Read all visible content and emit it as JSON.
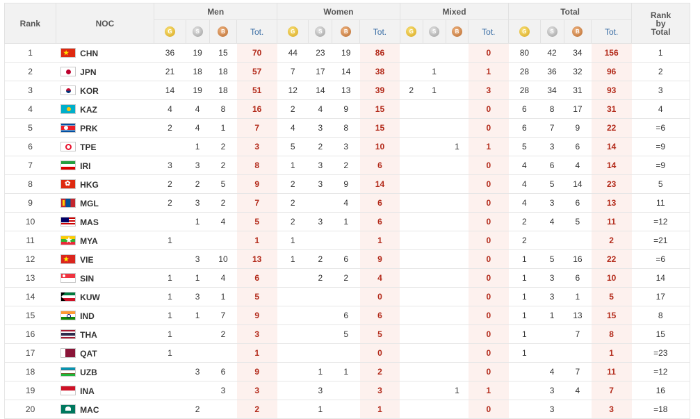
{
  "headers": {
    "rank": "Rank",
    "noc": "NOC",
    "groups": [
      "Men",
      "Women",
      "Mixed",
      "Total"
    ],
    "tot": "Tot.",
    "rank_by_total": [
      "Rank",
      "by",
      "Total"
    ],
    "medal_letters": {
      "gold": "G",
      "silver": "S",
      "bronze": "B"
    }
  },
  "colors": {
    "header_bg": "#f2f2f2",
    "total_cell_bg": "#fdf1ee",
    "total_text": "#b32a1a",
    "tot_header_text": "#3a6ea5"
  },
  "rows": [
    {
      "rank": "1",
      "noc": "CHN",
      "flag": "china-flag",
      "flag_colors": [
        "#de2910",
        "#ffde00"
      ],
      "men": [
        "36",
        "19",
        "15",
        "70"
      ],
      "women": [
        "44",
        "23",
        "19",
        "86"
      ],
      "mixed": [
        "",
        "",
        "",
        "0"
      ],
      "total": [
        "80",
        "42",
        "34",
        "156"
      ],
      "rbt": "1"
    },
    {
      "rank": "2",
      "noc": "JPN",
      "flag": "japan-flag",
      "flag_colors": [
        "#ffffff",
        "#bc002d"
      ],
      "men": [
        "21",
        "18",
        "18",
        "57"
      ],
      "women": [
        "7",
        "17",
        "14",
        "38"
      ],
      "mixed": [
        "",
        "1",
        "",
        "1"
      ],
      "total": [
        "28",
        "36",
        "32",
        "96"
      ],
      "rbt": "2"
    },
    {
      "rank": "3",
      "noc": "KOR",
      "flag": "korea-flag",
      "flag_colors": [
        "#ffffff",
        "#c60c30",
        "#003478"
      ],
      "men": [
        "14",
        "19",
        "18",
        "51"
      ],
      "women": [
        "12",
        "14",
        "13",
        "39"
      ],
      "mixed": [
        "2",
        "1",
        "",
        "3"
      ],
      "total": [
        "28",
        "34",
        "31",
        "93"
      ],
      "rbt": "3"
    },
    {
      "rank": "4",
      "noc": "KAZ",
      "flag": "kazakhstan-flag",
      "flag_colors": [
        "#00afca",
        "#fec50c"
      ],
      "men": [
        "4",
        "4",
        "8",
        "16"
      ],
      "women": [
        "2",
        "4",
        "9",
        "15"
      ],
      "mixed": [
        "",
        "",
        "",
        "0"
      ],
      "total": [
        "6",
        "8",
        "17",
        "31"
      ],
      "rbt": "4"
    },
    {
      "rank": "5",
      "noc": "PRK",
      "flag": "north-korea-flag",
      "flag_colors": [
        "#024fa2",
        "#ed1c27",
        "#ffffff"
      ],
      "men": [
        "2",
        "4",
        "1",
        "7"
      ],
      "women": [
        "4",
        "3",
        "8",
        "15"
      ],
      "mixed": [
        "",
        "",
        "",
        "0"
      ],
      "total": [
        "6",
        "7",
        "9",
        "22"
      ],
      "rbt": "=6"
    },
    {
      "rank": "6",
      "noc": "TPE",
      "flag": "chinese-taipei-flag",
      "flag_colors": [
        "#ffffff",
        "#1c3f94",
        "#e8112d"
      ],
      "men": [
        "",
        "1",
        "2",
        "3"
      ],
      "women": [
        "5",
        "2",
        "3",
        "10"
      ],
      "mixed": [
        "",
        "",
        "1",
        "1"
      ],
      "total": [
        "5",
        "3",
        "6",
        "14"
      ],
      "rbt": "=9"
    },
    {
      "rank": "7",
      "noc": "IRI",
      "flag": "iran-flag",
      "flag_colors": [
        "#239f40",
        "#ffffff",
        "#da0000"
      ],
      "men": [
        "3",
        "3",
        "2",
        "8"
      ],
      "women": [
        "1",
        "3",
        "2",
        "6"
      ],
      "mixed": [
        "",
        "",
        "",
        "0"
      ],
      "total": [
        "4",
        "6",
        "4",
        "14"
      ],
      "rbt": "=9"
    },
    {
      "rank": "8",
      "noc": "HKG",
      "flag": "hong-kong-flag",
      "flag_colors": [
        "#de2910",
        "#ffffff"
      ],
      "men": [
        "2",
        "2",
        "5",
        "9"
      ],
      "women": [
        "2",
        "3",
        "9",
        "14"
      ],
      "mixed": [
        "",
        "",
        "",
        "0"
      ],
      "total": [
        "4",
        "5",
        "14",
        "23"
      ],
      "rbt": "5"
    },
    {
      "rank": "9",
      "noc": "MGL",
      "flag": "mongolia-flag",
      "flag_colors": [
        "#c4272f",
        "#015197",
        "#f9cf02"
      ],
      "men": [
        "2",
        "3",
        "2",
        "7"
      ],
      "women": [
        "2",
        "",
        "4",
        "6"
      ],
      "mixed": [
        "",
        "",
        "",
        "0"
      ],
      "total": [
        "4",
        "3",
        "6",
        "13"
      ],
      "rbt": "11"
    },
    {
      "rank": "10",
      "noc": "MAS",
      "flag": "malaysia-flag",
      "flag_colors": [
        "#cc0001",
        "#ffffff",
        "#010066",
        "#ffcc00"
      ],
      "men": [
        "",
        "1",
        "4",
        "5"
      ],
      "women": [
        "2",
        "3",
        "1",
        "6"
      ],
      "mixed": [
        "",
        "",
        "",
        "0"
      ],
      "total": [
        "2",
        "4",
        "5",
        "11"
      ],
      "rbt": "=12"
    },
    {
      "rank": "11",
      "noc": "MYA",
      "flag": "myanmar-flag",
      "flag_colors": [
        "#fecb00",
        "#34b233",
        "#ea2839",
        "#ffffff"
      ],
      "men": [
        "1",
        "",
        "",
        "1"
      ],
      "women": [
        "1",
        "",
        "",
        "1"
      ],
      "mixed": [
        "",
        "",
        "",
        "0"
      ],
      "total": [
        "2",
        "",
        "",
        "2"
      ],
      "rbt": "=21"
    },
    {
      "rank": "12",
      "noc": "VIE",
      "flag": "vietnam-flag",
      "flag_colors": [
        "#da251d",
        "#ffff00"
      ],
      "men": [
        "",
        "3",
        "10",
        "13"
      ],
      "women": [
        "1",
        "2",
        "6",
        "9"
      ],
      "mixed": [
        "",
        "",
        "",
        "0"
      ],
      "total": [
        "1",
        "5",
        "16",
        "22"
      ],
      "rbt": "=6"
    },
    {
      "rank": "13",
      "noc": "SIN",
      "flag": "singapore-flag",
      "flag_colors": [
        "#ef3340",
        "#ffffff"
      ],
      "men": [
        "1",
        "1",
        "4",
        "6"
      ],
      "women": [
        "",
        "2",
        "2",
        "4"
      ],
      "mixed": [
        "",
        "",
        "",
        "0"
      ],
      "total": [
        "1",
        "3",
        "6",
        "10"
      ],
      "rbt": "14"
    },
    {
      "rank": "14",
      "noc": "KUW",
      "flag": "kuwait-flag",
      "flag_colors": [
        "#007a3d",
        "#ffffff",
        "#ce1126",
        "#000000"
      ],
      "men": [
        "1",
        "3",
        "1",
        "5"
      ],
      "women": [
        "",
        "",
        "",
        "0"
      ],
      "mixed": [
        "",
        "",
        "",
        "0"
      ],
      "total": [
        "1",
        "3",
        "1",
        "5"
      ],
      "rbt": "17"
    },
    {
      "rank": "15",
      "noc": "IND",
      "flag": "india-flag",
      "flag_colors": [
        "#ff9933",
        "#ffffff",
        "#138808",
        "#000080"
      ],
      "men": [
        "1",
        "1",
        "7",
        "9"
      ],
      "women": [
        "",
        "",
        "6",
        "6"
      ],
      "mixed": [
        "",
        "",
        "",
        "0"
      ],
      "total": [
        "1",
        "1",
        "13",
        "15"
      ],
      "rbt": "8"
    },
    {
      "rank": "16",
      "noc": "THA",
      "flag": "thailand-flag",
      "flag_colors": [
        "#a51931",
        "#f4f5f8",
        "#2d2a4a"
      ],
      "men": [
        "1",
        "",
        "2",
        "3"
      ],
      "women": [
        "",
        "",
        "5",
        "5"
      ],
      "mixed": [
        "",
        "",
        "",
        "0"
      ],
      "total": [
        "1",
        "",
        "7",
        "8"
      ],
      "rbt": "15"
    },
    {
      "rank": "17",
      "noc": "QAT",
      "flag": "qatar-flag",
      "flag_colors": [
        "#ffffff",
        "#8a1538"
      ],
      "men": [
        "1",
        "",
        "",
        "1"
      ],
      "women": [
        "",
        "",
        "",
        "0"
      ],
      "mixed": [
        "",
        "",
        "",
        "0"
      ],
      "total": [
        "1",
        "",
        "",
        "1"
      ],
      "rbt": "=23"
    },
    {
      "rank": "18",
      "noc": "UZB",
      "flag": "uzbekistan-flag",
      "flag_colors": [
        "#1eb53a",
        "#ffffff",
        "#0099b5",
        "#ce1126"
      ],
      "men": [
        "",
        "3",
        "6",
        "9"
      ],
      "women": [
        "",
        "1",
        "1",
        "2"
      ],
      "mixed": [
        "",
        "",
        "",
        "0"
      ],
      "total": [
        "",
        "4",
        "7",
        "11"
      ],
      "rbt": "=12"
    },
    {
      "rank": "19",
      "noc": "INA",
      "flag": "indonesia-flag",
      "flag_colors": [
        "#ce1126",
        "#ffffff"
      ],
      "men": [
        "",
        "",
        "3",
        "3"
      ],
      "women": [
        "",
        "3",
        "",
        "3"
      ],
      "mixed": [
        "",
        "",
        "1",
        "1"
      ],
      "total": [
        "",
        "3",
        "4",
        "7"
      ],
      "rbt": "16"
    },
    {
      "rank": "20",
      "noc": "MAC",
      "flag": "macau-flag",
      "flag_colors": [
        "#00785e",
        "#ffffff",
        "#fbd116"
      ],
      "men": [
        "",
        "2",
        "",
        "2"
      ],
      "women": [
        "",
        "1",
        "",
        "1"
      ],
      "mixed": [
        "",
        "",
        "",
        "0"
      ],
      "total": [
        "",
        "3",
        "",
        "3"
      ],
      "rbt": "=18"
    }
  ]
}
